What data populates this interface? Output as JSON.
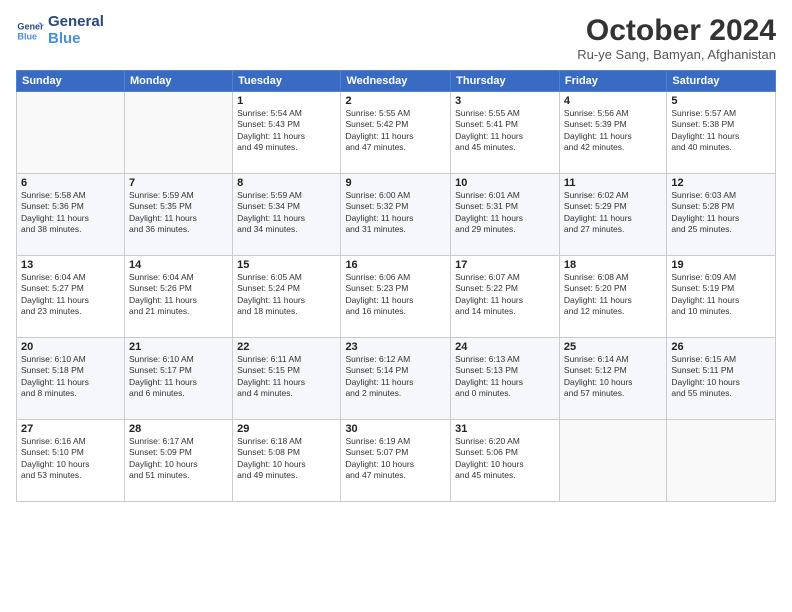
{
  "logo": {
    "line1": "General",
    "line2": "Blue"
  },
  "title": "October 2024",
  "location": "Ru-ye Sang, Bamyan, Afghanistan",
  "header_days": [
    "Sunday",
    "Monday",
    "Tuesday",
    "Wednesday",
    "Thursday",
    "Friday",
    "Saturday"
  ],
  "weeks": [
    [
      {
        "day": "",
        "info": ""
      },
      {
        "day": "",
        "info": ""
      },
      {
        "day": "1",
        "info": "Sunrise: 5:54 AM\nSunset: 5:43 PM\nDaylight: 11 hours\nand 49 minutes."
      },
      {
        "day": "2",
        "info": "Sunrise: 5:55 AM\nSunset: 5:42 PM\nDaylight: 11 hours\nand 47 minutes."
      },
      {
        "day": "3",
        "info": "Sunrise: 5:55 AM\nSunset: 5:41 PM\nDaylight: 11 hours\nand 45 minutes."
      },
      {
        "day": "4",
        "info": "Sunrise: 5:56 AM\nSunset: 5:39 PM\nDaylight: 11 hours\nand 42 minutes."
      },
      {
        "day": "5",
        "info": "Sunrise: 5:57 AM\nSunset: 5:38 PM\nDaylight: 11 hours\nand 40 minutes."
      }
    ],
    [
      {
        "day": "6",
        "info": "Sunrise: 5:58 AM\nSunset: 5:36 PM\nDaylight: 11 hours\nand 38 minutes."
      },
      {
        "day": "7",
        "info": "Sunrise: 5:59 AM\nSunset: 5:35 PM\nDaylight: 11 hours\nand 36 minutes."
      },
      {
        "day": "8",
        "info": "Sunrise: 5:59 AM\nSunset: 5:34 PM\nDaylight: 11 hours\nand 34 minutes."
      },
      {
        "day": "9",
        "info": "Sunrise: 6:00 AM\nSunset: 5:32 PM\nDaylight: 11 hours\nand 31 minutes."
      },
      {
        "day": "10",
        "info": "Sunrise: 6:01 AM\nSunset: 5:31 PM\nDaylight: 11 hours\nand 29 minutes."
      },
      {
        "day": "11",
        "info": "Sunrise: 6:02 AM\nSunset: 5:29 PM\nDaylight: 11 hours\nand 27 minutes."
      },
      {
        "day": "12",
        "info": "Sunrise: 6:03 AM\nSunset: 5:28 PM\nDaylight: 11 hours\nand 25 minutes."
      }
    ],
    [
      {
        "day": "13",
        "info": "Sunrise: 6:04 AM\nSunset: 5:27 PM\nDaylight: 11 hours\nand 23 minutes."
      },
      {
        "day": "14",
        "info": "Sunrise: 6:04 AM\nSunset: 5:26 PM\nDaylight: 11 hours\nand 21 minutes."
      },
      {
        "day": "15",
        "info": "Sunrise: 6:05 AM\nSunset: 5:24 PM\nDaylight: 11 hours\nand 18 minutes."
      },
      {
        "day": "16",
        "info": "Sunrise: 6:06 AM\nSunset: 5:23 PM\nDaylight: 11 hours\nand 16 minutes."
      },
      {
        "day": "17",
        "info": "Sunrise: 6:07 AM\nSunset: 5:22 PM\nDaylight: 11 hours\nand 14 minutes."
      },
      {
        "day": "18",
        "info": "Sunrise: 6:08 AM\nSunset: 5:20 PM\nDaylight: 11 hours\nand 12 minutes."
      },
      {
        "day": "19",
        "info": "Sunrise: 6:09 AM\nSunset: 5:19 PM\nDaylight: 11 hours\nand 10 minutes."
      }
    ],
    [
      {
        "day": "20",
        "info": "Sunrise: 6:10 AM\nSunset: 5:18 PM\nDaylight: 11 hours\nand 8 minutes."
      },
      {
        "day": "21",
        "info": "Sunrise: 6:10 AM\nSunset: 5:17 PM\nDaylight: 11 hours\nand 6 minutes."
      },
      {
        "day": "22",
        "info": "Sunrise: 6:11 AM\nSunset: 5:15 PM\nDaylight: 11 hours\nand 4 minutes."
      },
      {
        "day": "23",
        "info": "Sunrise: 6:12 AM\nSunset: 5:14 PM\nDaylight: 11 hours\nand 2 minutes."
      },
      {
        "day": "24",
        "info": "Sunrise: 6:13 AM\nSunset: 5:13 PM\nDaylight: 11 hours\nand 0 minutes."
      },
      {
        "day": "25",
        "info": "Sunrise: 6:14 AM\nSunset: 5:12 PM\nDaylight: 10 hours\nand 57 minutes."
      },
      {
        "day": "26",
        "info": "Sunrise: 6:15 AM\nSunset: 5:11 PM\nDaylight: 10 hours\nand 55 minutes."
      }
    ],
    [
      {
        "day": "27",
        "info": "Sunrise: 6:16 AM\nSunset: 5:10 PM\nDaylight: 10 hours\nand 53 minutes."
      },
      {
        "day": "28",
        "info": "Sunrise: 6:17 AM\nSunset: 5:09 PM\nDaylight: 10 hours\nand 51 minutes."
      },
      {
        "day": "29",
        "info": "Sunrise: 6:18 AM\nSunset: 5:08 PM\nDaylight: 10 hours\nand 49 minutes."
      },
      {
        "day": "30",
        "info": "Sunrise: 6:19 AM\nSunset: 5:07 PM\nDaylight: 10 hours\nand 47 minutes."
      },
      {
        "day": "31",
        "info": "Sunrise: 6:20 AM\nSunset: 5:06 PM\nDaylight: 10 hours\nand 45 minutes."
      },
      {
        "day": "",
        "info": ""
      },
      {
        "day": "",
        "info": ""
      }
    ]
  ]
}
